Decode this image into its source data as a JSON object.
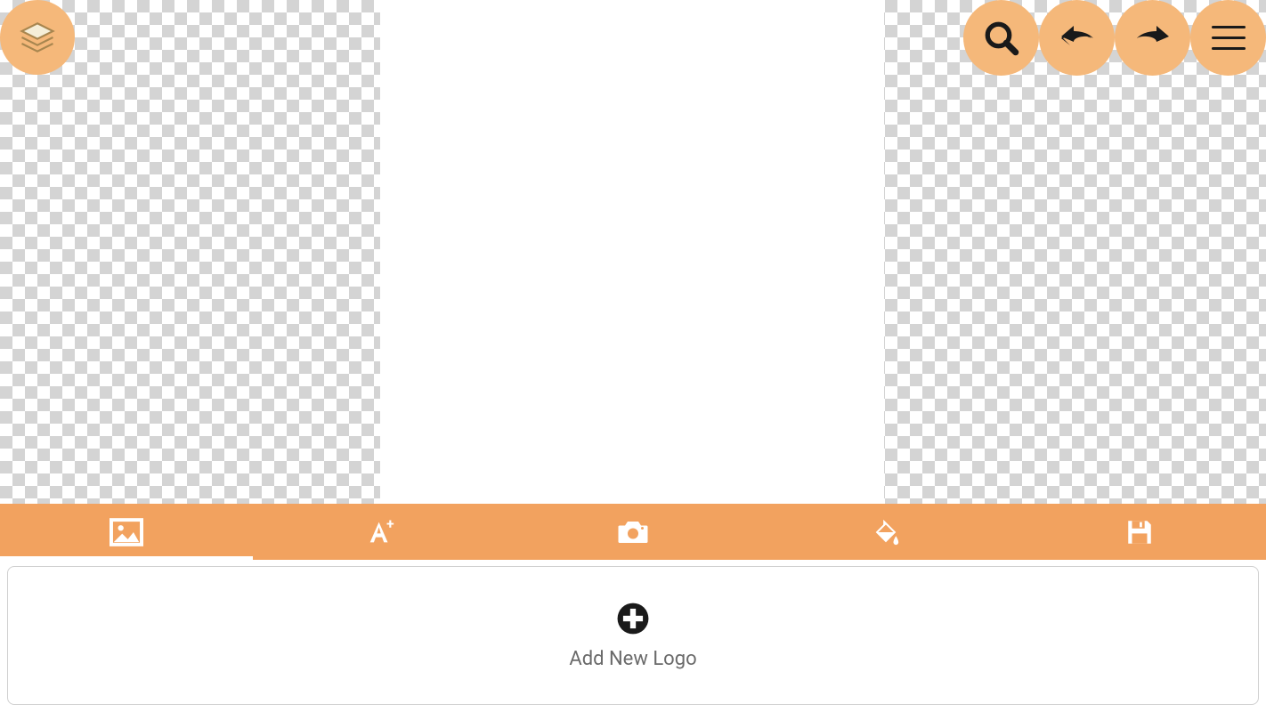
{
  "topLeft": {
    "label": "layers"
  },
  "topRight": {
    "zoom": "zoom",
    "undo": "undo",
    "redo": "redo",
    "menu": "menu"
  },
  "toolbar": {
    "items": [
      {
        "id": "image",
        "label": "Image",
        "active": true
      },
      {
        "id": "text",
        "label": "Text",
        "active": false
      },
      {
        "id": "camera",
        "label": "Camera",
        "active": false
      },
      {
        "id": "fill",
        "label": "Fill",
        "active": false
      },
      {
        "id": "save",
        "label": "Save",
        "active": false
      }
    ]
  },
  "addLogo": {
    "label": "Add New Logo"
  }
}
